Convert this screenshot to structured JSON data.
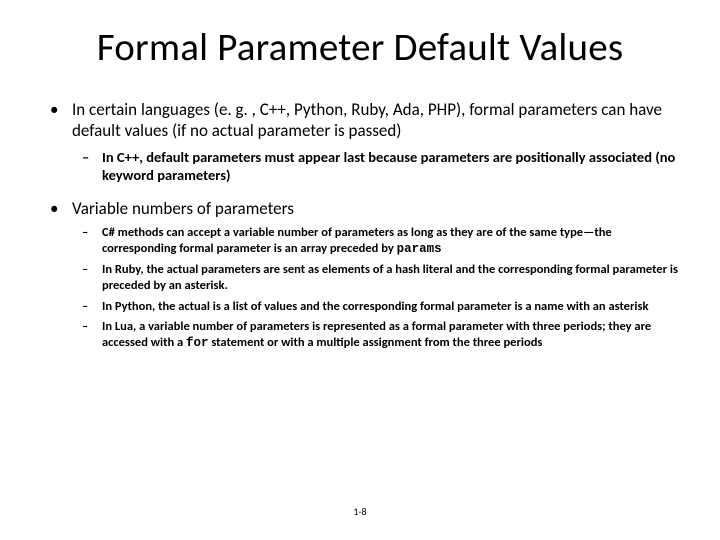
{
  "title": "Formal Parameter Default Values",
  "bullets": {
    "b1": "In certain languages (e. g. , C++, Python, Ruby, Ada, PHP), formal parameters can have default values (if no actual parameter is passed)",
    "b1s1": "In C++, default parameters must appear last because parameters are positionally associated (no keyword parameters)",
    "b2": "Variable numbers of parameters",
    "b2s1a": "C# methods can accept a variable number of parameters as long as they are of the same type—the corresponding formal parameter is an array preceded by ",
    "b2s1code": "params",
    "b2s2": "In Ruby, the actual parameters are sent as elements of a hash literal and the corresponding formal parameter is preceded by an asterisk.",
    "b2s3": "In Python, the actual is a list of values and the corresponding formal parameter is a name with an asterisk",
    "b2s4a": "In Lua, a variable number of parameters is represented as a formal parameter with three periods; they are accessed with a ",
    "b2s4code": "for",
    "b2s4b": " statement or with a multiple assignment from the three periods"
  },
  "pagenum": "1-8"
}
